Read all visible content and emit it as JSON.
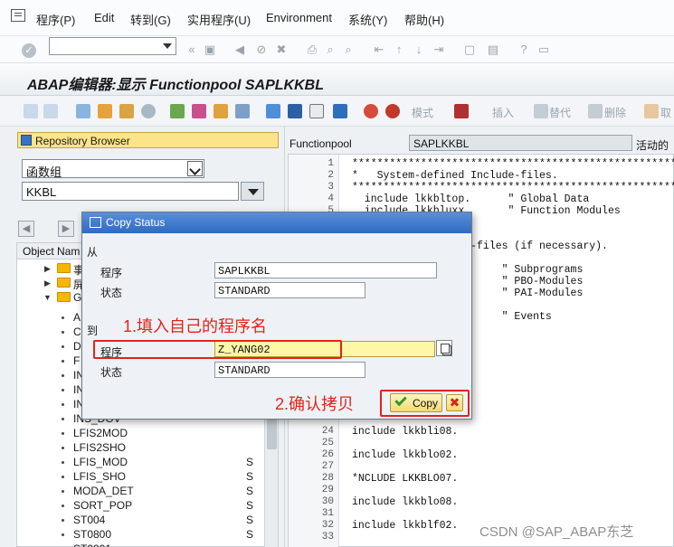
{
  "menu": [
    "程序(P)",
    "Edit",
    "转到(G)",
    "实用程序(U)",
    "Environment",
    "系统(Y)",
    "帮助(H)"
  ],
  "title": "ABAP编辑器:显示 Functionpool SAPLKKBL",
  "app_toolbar": {
    "mode": "模式",
    "insert": "插入",
    "replace": "替代",
    "delete": "删除",
    "cancel": "取"
  },
  "repository": {
    "title": "Repository Browser",
    "object_type": "函数组",
    "object_name": "KKBL",
    "column_header": "Object Nam",
    "top_nodes": [
      {
        "label": "事",
        "expanded": false
      },
      {
        "label": "屏",
        "expanded": false
      },
      {
        "label": "G",
        "expanded": true
      }
    ],
    "items": [
      {
        "label": "A",
        "flag": ""
      },
      {
        "label": "C",
        "flag": ""
      },
      {
        "label": "D",
        "flag": ""
      },
      {
        "label": "F",
        "flag": ""
      },
      {
        "label": "IN",
        "flag": ""
      },
      {
        "label": "IN",
        "flag": ""
      },
      {
        "label": "IN",
        "flag": ""
      },
      {
        "label": "INS_DOV",
        "flag": ""
      },
      {
        "label": "LFIS2MOD",
        "flag": ""
      },
      {
        "label": "LFIS2SHO",
        "flag": ""
      },
      {
        "label": "LFIS_MOD",
        "flag": "S"
      },
      {
        "label": "LFIS_SHO",
        "flag": "S"
      },
      {
        "label": "MODA_DET",
        "flag": "S"
      },
      {
        "label": "SORT_POP",
        "flag": "S"
      },
      {
        "label": "ST004",
        "flag": "S"
      },
      {
        "label": "ST0800",
        "flag": "S"
      },
      {
        "label": "ST0801",
        "flag": ""
      }
    ]
  },
  "editor": {
    "program_label": "Functionpool",
    "program_name": "SAPLKKBL",
    "status": "活动的",
    "lines": [
      {
        "n": "1",
        "text": "*****************************************************"
      },
      {
        "n": "2",
        "text": "*   System-defined Include-files."
      },
      {
        "n": "3",
        "text": "*****************************************************"
      },
      {
        "n": "4",
        "text": "  include lkkbltop.      \" Global Data"
      },
      {
        "n": "5",
        "text": "  include lkkbluxx.      \" Function Modules"
      },
      {
        "n": "",
        "text": ""
      },
      {
        "n": "",
        "text": "**********"
      },
      {
        "n": "",
        "text": "              clude-files (if necessary)."
      },
      {
        "n": "",
        "text": "**********"
      },
      {
        "n": "",
        "text": "                        \" Subprograms"
      },
      {
        "n": "",
        "text": "                        \" PBO-Modules"
      },
      {
        "n": "",
        "text": "                        \" PAI-Modules"
      },
      {
        "n": "",
        "text": ""
      },
      {
        "n": "",
        "text": "                        \" Events"
      },
      {
        "n": "24",
        "text": "include lkkbli08."
      },
      {
        "n": "25",
        "text": ""
      },
      {
        "n": "26",
        "text": "include lkkblo02."
      },
      {
        "n": "27",
        "text": ""
      },
      {
        "n": "28",
        "text": "*NCLUDE LKKBLO07."
      },
      {
        "n": "29",
        "text": ""
      },
      {
        "n": "30",
        "text": "include lkkblo08."
      },
      {
        "n": "31",
        "text": ""
      },
      {
        "n": "32",
        "text": "include lkkblf02."
      },
      {
        "n": "33",
        "text": ""
      }
    ]
  },
  "dialog": {
    "title": "Copy Status",
    "from_label": "从",
    "to_label": "到",
    "program_label": "程序",
    "status_label": "状态",
    "from_program": "SAPLKKBL",
    "from_status": "STANDARD",
    "to_program": "Z_YANG02",
    "to_status": "STANDARD",
    "copy_label": "Copy",
    "cancel_label": "✖"
  },
  "annotations": {
    "step1": "1.填入自己的程序名",
    "step2": "2.确认拷贝"
  },
  "watermark": "CSDN @SAP_ABAP东芝"
}
